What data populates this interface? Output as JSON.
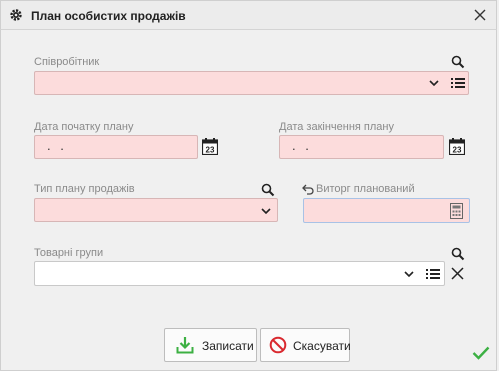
{
  "window": {
    "title": "План особистих продажів"
  },
  "fields": {
    "employee": {
      "label": "Співробітник",
      "value": ""
    },
    "date_start": {
      "label": "Дата початку плану",
      "value": " .  ."
    },
    "date_end": {
      "label": "Дата закінчення плану",
      "value": " .  ."
    },
    "plan_type": {
      "label": "Тип плану продажів",
      "value": ""
    },
    "revenue": {
      "label": "Виторг планований",
      "value": ""
    },
    "product_groups": {
      "label": "Товарні групи",
      "value": ""
    }
  },
  "buttons": {
    "save": "Записати",
    "cancel": "Скасувати"
  },
  "colors": {
    "required_bg": "#fcdcdc",
    "accent_green": "#3cb043",
    "cancel_red": "#d9292f"
  }
}
